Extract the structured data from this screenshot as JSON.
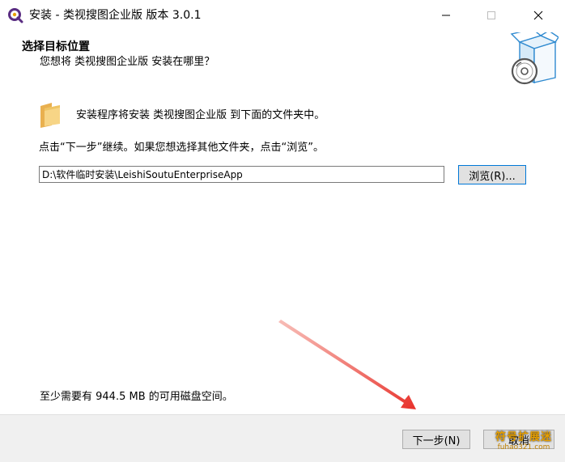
{
  "window": {
    "title": "安装 - 类视搜图企业版 版本 3.0.1",
    "icon": "magnifier-q-icon"
  },
  "header": {
    "title": "选择目标位置",
    "subtitle": "您想将 类视搜图企业版 安装在哪里？",
    "graphic": "software-box-disc-icon"
  },
  "body": {
    "install_line": "安装程序将安装 类视搜图企业版 到下面的文件夹中。",
    "instruction": "点击“下一步”继续。如果您想选择其他文件夹，点击“浏览”。",
    "path_value": "D:\\软件临时安装\\LeishiSoutuEnterpriseApp",
    "browse_label": "浏览(R)...",
    "space_required": "至少需要有 944.5 MB 的可用磁盘空间。"
  },
  "footer": {
    "next_label": "下一步(N)",
    "cancel_label": "取消"
  },
  "watermark": {
    "main": "符号扩展迷",
    "sub": "fuhao321.com"
  },
  "colors": {
    "accent": "#0078d7",
    "footer_bg": "#f0f0f0",
    "annotation_arrow": "#e8302a",
    "folder": "#f2c46b"
  }
}
